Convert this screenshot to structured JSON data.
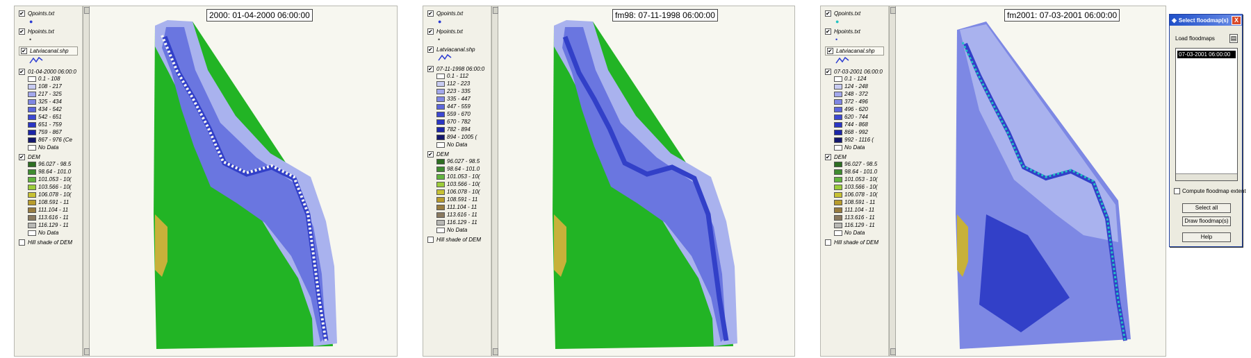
{
  "legend_common": {
    "qpoints": "Qpoints.txt",
    "hpoints": "Hpoints.txt",
    "latvia": "Latviacanal.shp",
    "dem": "DEM",
    "dem_classes": [
      "96.027 - 98.5",
      "98.64 - 101.0",
      "101.053 - 10(",
      "103.566 - 10(",
      "106.078 - 10(",
      "108.591 - 11",
      "111.104 - 11",
      "113.616 - 11",
      "116.129 - 11",
      "No Data"
    ],
    "hillshade": "Hill shade of DEM"
  },
  "panels": [
    {
      "map_title": "2000: 01-04-2000 06:00:00",
      "flood_layer": "01-04-2000 06:00:0",
      "flood_classes": [
        "0.1 - 108",
        "108 - 217",
        "217 - 325",
        "325 - 434",
        "434 - 542",
        "542 - 651",
        "651 - 759",
        "759 - 867",
        "867 - 976 (Ce",
        "No Data"
      ]
    },
    {
      "map_title": "fm98: 07-11-1998 06:00:00",
      "flood_layer": "07-11-1998 06:00:0",
      "flood_classes": [
        "0.1 - 112",
        "112 - 223",
        "223 - 335",
        "335 - 447",
        "447 - 559",
        "559 - 670",
        "670 - 782",
        "782 - 894",
        "894 - 1005 (",
        "No Data"
      ]
    },
    {
      "map_title": "fm2001: 07-03-2001 06:00:00",
      "flood_layer": "07-03-2001 06:00:0",
      "flood_classes": [
        "0.1 - 124",
        "124 - 248",
        "248 - 372",
        "372 - 496",
        "496 - 620",
        "620 - 744",
        "744 - 868",
        "868 - 992",
        "992 - 1116 (",
        "No Data"
      ]
    }
  ],
  "dialog": {
    "title": "Select floodmap(s)",
    "close": "X",
    "list_label": "Load floodmaps",
    "list_items": [
      "07-03-2001 06:00:00"
    ],
    "compute_label": "Compute floodmap extent",
    "select_all": "Select all",
    "draw": "Draw floodmap(s)",
    "help": "Help"
  },
  "colors": {
    "flood": [
      "#ffffff",
      "#c8ccf2",
      "#a3a8ec",
      "#8088e4",
      "#5c66dc",
      "#3c48d2",
      "#2a36c4",
      "#1c26a8",
      "#14186e",
      "#ffffff"
    ],
    "dem": [
      "#2e6e22",
      "#3f8c30",
      "#62b43e",
      "#9ccc3a",
      "#c8c234",
      "#b89c2c",
      "#987c40",
      "#8a7a60",
      "#b8b8b4",
      "#ffffff"
    ],
    "terrain": "#22b425",
    "flood_shallow": "#a9b2ee",
    "flood_mid": "#6a76e0",
    "flood_deep": "#3240c8",
    "route_white": "#f4f4f4",
    "route_cyan": "#23c3c3"
  }
}
